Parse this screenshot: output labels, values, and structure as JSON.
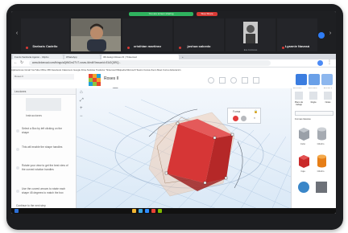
{
  "meeting": {
    "share_label": "You are screen sharing",
    "stop_label": "Stop Share",
    "participants": [
      {
        "name": "Darlazis Cadello",
        "caption": ""
      },
      {
        "name": "",
        "caption": ""
      },
      {
        "name": "cristhian martinez",
        "caption": ""
      },
      {
        "name": "joshua salcedo",
        "caption": ""
      },
      {
        "name": "",
        "caption": "Eva Contreras"
      },
      {
        "name": "Lyannie Navasá",
        "caption": ""
      }
    ]
  },
  "browser": {
    "tabs": [
      "Fondo Sanitaria Agosto - Clipbo",
      "WhatsApp",
      "3D design Roses III | Tinkercad",
      "+"
    ],
    "url": "www.tinkercad.com/things/a2jtMGm2TV7-roses-iii/edit?lessonid=EAGQ5RQ...",
    "bookmarks": "Aplicaciones  Gmail  YouTube  Office 365  Facebook  Classroom  Google Drive  Noticias  Traductor  Tinkercad  Wikipedia  Microsoft Teams  Canva  Zoom  Meet  Correo  Educación"
  },
  "tinkercad": {
    "title": "Roses II",
    "actions": [
      "Importar",
      "Exportar",
      "Enviar a"
    ],
    "panel_tabs": [
      "Plano de trabajo",
      "Regla",
      "Notas"
    ],
    "basic_label": "Formas básicas"
  },
  "lesson": {
    "header": "Lecciones",
    "subheader": "Instrucciones",
    "steps": [
      "Select a Box by left clicking on the shape",
      "This will enable the shape handles",
      "Rotate your view to get the best view of the curved rotation handles",
      "Use the curved arrows to rotate each shape 45 degrees to match the box",
      "Continue to the next step"
    ]
  },
  "inspector": {
    "title": "Forma",
    "colors": [
      "#e23b3b",
      "#b7b9bd"
    ]
  },
  "shapes": [
    "Cubo",
    "Cilindro",
    "Caja",
    "Cilindro"
  ],
  "colors": {
    "accent": "#2f7df6",
    "box_red": "#d93b3b",
    "orange": "#ef8a1d",
    "zoom_green": "#2fb35f",
    "zoom_red": "#d93a35"
  }
}
